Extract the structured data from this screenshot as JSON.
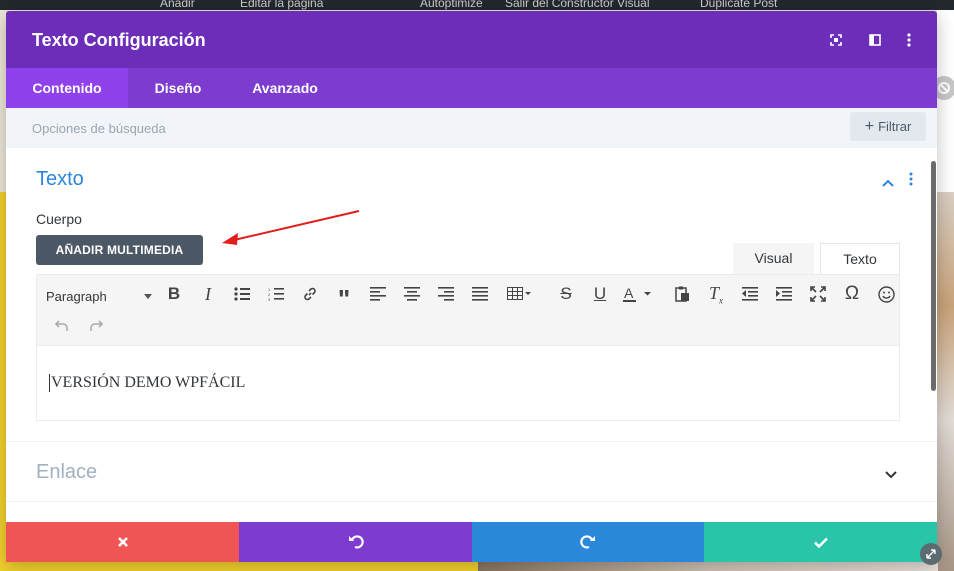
{
  "modal": {
    "title": "Texto Configuración",
    "tabs": [
      {
        "label": "Contenido",
        "active": true
      },
      {
        "label": "Diseño",
        "active": false
      },
      {
        "label": "Avanzado",
        "active": false
      }
    ],
    "search_placeholder": "Opciones de búsqueda",
    "filter_label": "Filtrar",
    "accent_color": "#6c2eb9",
    "tab_bar_color": "#7e3bd0"
  },
  "section_text": {
    "title": "Texto",
    "field_label": "Cuerpo",
    "media_button": "AÑADIR MULTIMEDIA",
    "editor_tabs": [
      "Visual",
      "Texto"
    ],
    "format_select": "Paragraph",
    "content": "VERSIÓN DEMO WPFÁCIL"
  },
  "section_link": {
    "title": "Enlace"
  },
  "toolbar_icons": [
    "bold-icon",
    "italic-icon",
    "bullet-list-icon",
    "numbered-list-icon",
    "link-icon",
    "blockquote-icon",
    "align-left-icon",
    "align-center-icon",
    "align-right-icon",
    "align-justify-icon",
    "table-icon",
    "strikethrough-icon",
    "underline-icon",
    "text-color-icon",
    "paste-icon",
    "clear-format-icon",
    "outdent-icon",
    "indent-icon",
    "fullscreen-icon",
    "omega-icon",
    "emoji-icon",
    "undo-icon",
    "redo-icon"
  ],
  "footer": {
    "cancel_color": "#ef5555",
    "undo_color": "#7e3bd0",
    "redo_color": "#2b87da",
    "save_color": "#29c4a9"
  },
  "topbar": {
    "items": [
      "Añadir",
      "Editar la página",
      "Autoptimize",
      "Salir del Constructor Visual",
      "Duplicate Post"
    ]
  }
}
